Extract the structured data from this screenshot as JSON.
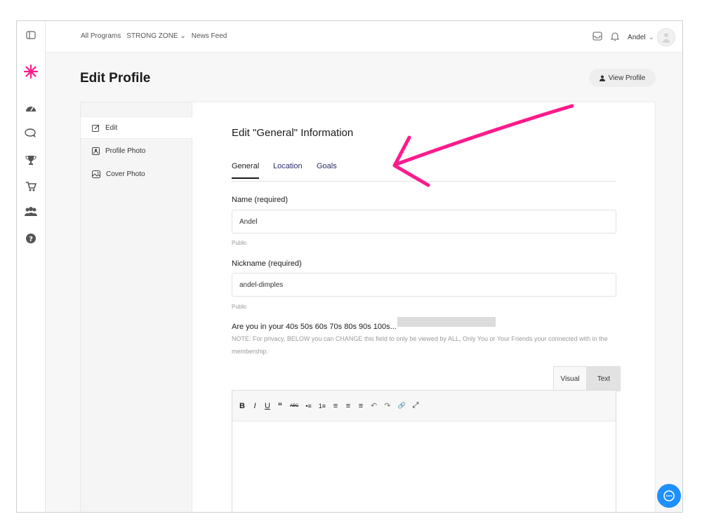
{
  "topbar": {
    "nav": [
      "All Programs",
      "STRONG ZONE",
      "News Feed"
    ],
    "user_name": "Andel"
  },
  "page": {
    "title": "Edit Profile",
    "view_profile_label": "View Profile"
  },
  "edit_menu": {
    "items": [
      {
        "label": "Edit",
        "icon": "pencil-icon",
        "active": true
      },
      {
        "label": "Profile Photo",
        "icon": "profile-photo-icon",
        "active": false
      },
      {
        "label": "Cover Photo",
        "icon": "cover-photo-icon",
        "active": false
      }
    ]
  },
  "section": {
    "title": "Edit \"General\" Information",
    "tabs": [
      "General",
      "Location",
      "Goals"
    ],
    "active_tab": "General"
  },
  "fields": {
    "name_label": "Name (required)",
    "name_value": "Andel",
    "name_visibility": "Public",
    "nickname_label": "Nickname (required)",
    "nickname_value": "andel-dimples",
    "nickname_visibility": "Public",
    "age_label": "Are you in your 40s 50s 60s 70s 80s 90s 100s...",
    "age_note": "NOTE: For privacy, BELOW you can CHANGE this field to only be viewed by ALL, Only You or Your Friends your connected with in the membership."
  },
  "editor": {
    "tab_visual": "Visual",
    "tab_text": "Text",
    "toolbar": [
      "B",
      "I",
      "U",
      "“",
      "ABC",
      "•≡",
      "1≡",
      "≡",
      "≡",
      "≡",
      "↶",
      "↷",
      "🔗",
      "⤢"
    ]
  },
  "colors": {
    "accent": "#ff1a8c",
    "chat": "#1e90ff"
  }
}
